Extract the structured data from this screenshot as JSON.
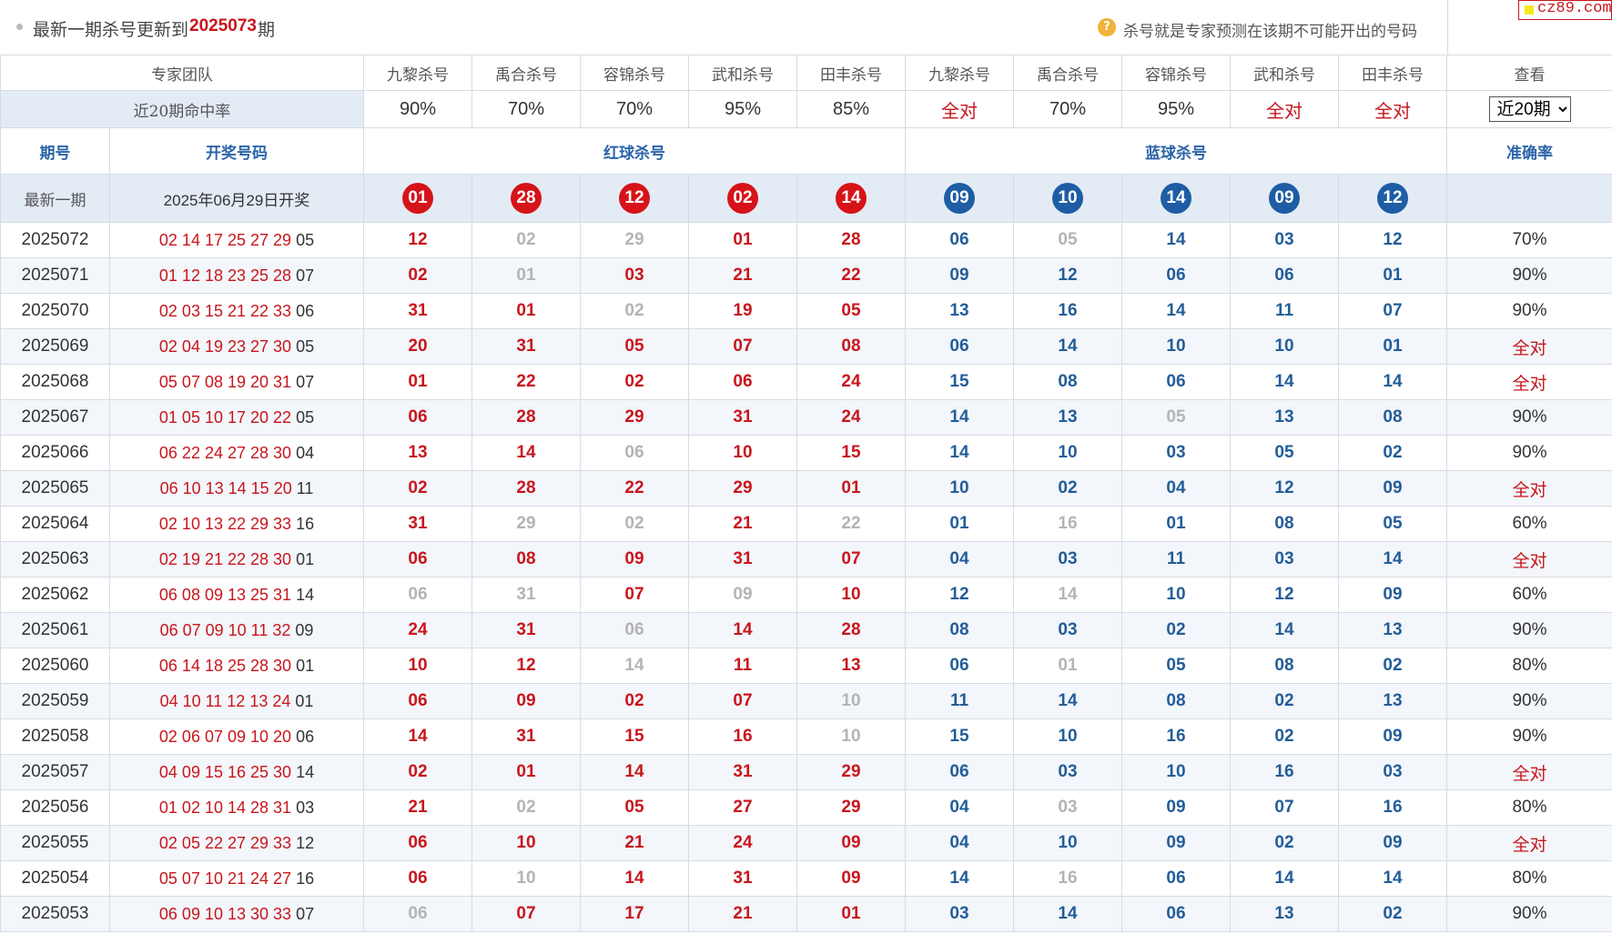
{
  "title": {
    "prefix": "最新一期杀号更新到",
    "issue": "2025073",
    "suffix": "期",
    "hint_icon": "question-icon",
    "hint_glyph": "?",
    "hint": "杀号就是专家预测在该期不可能开出的号码"
  },
  "logo": {
    "text": "cz89.com"
  },
  "header": {
    "team_label": "专家团队",
    "experts": [
      "九黎杀号",
      "禹合杀号",
      "容锦杀号",
      "武和杀号",
      "田丰杀号",
      "九黎杀号",
      "禹合杀号",
      "容锦杀号",
      "武和杀号",
      "田丰杀号"
    ],
    "view_label": "查看",
    "rate_label": "近20期命中率",
    "rates": [
      "90%",
      "70%",
      "70%",
      "95%",
      "85%",
      "全对",
      "70%",
      "95%",
      "全对",
      "全对"
    ],
    "period_select": {
      "selected": "近20期",
      "options": [
        "近20期"
      ]
    },
    "col_issue": "期号",
    "col_draw": "开奖号码",
    "col_red": "红球杀号",
    "col_blue": "蓝球杀号",
    "col_accuracy": "准确率",
    "latest_label": "最新一期",
    "latest_date": "2025年06月29日开奖",
    "latest_red": [
      "01",
      "28",
      "12",
      "02",
      "14"
    ],
    "latest_blue": [
      "09",
      "10",
      "14",
      "09",
      "12"
    ]
  },
  "rows": [
    {
      "issue": "2025072",
      "draw": "02 14 17 25 27 29",
      "blue_ball": "05",
      "red": [
        "12",
        "02",
        "29",
        "01",
        "28"
      ],
      "red_miss": [
        0,
        1,
        1,
        0,
        0
      ],
      "blue": [
        "06",
        "05",
        "14",
        "03",
        "12"
      ],
      "blue_miss": [
        0,
        1,
        0,
        0,
        0
      ],
      "accuracy": "70%"
    },
    {
      "issue": "2025071",
      "draw": "01 12 18 23 25 28",
      "blue_ball": "07",
      "red": [
        "02",
        "01",
        "03",
        "21",
        "22"
      ],
      "red_miss": [
        0,
        1,
        0,
        0,
        0
      ],
      "blue": [
        "09",
        "12",
        "06",
        "06",
        "01"
      ],
      "blue_miss": [
        0,
        0,
        0,
        0,
        0
      ],
      "accuracy": "90%"
    },
    {
      "issue": "2025070",
      "draw": "02 03 15 21 22 33",
      "blue_ball": "06",
      "red": [
        "31",
        "01",
        "02",
        "19",
        "05"
      ],
      "red_miss": [
        0,
        0,
        1,
        0,
        0
      ],
      "blue": [
        "13",
        "16",
        "14",
        "11",
        "07"
      ],
      "blue_miss": [
        0,
        0,
        0,
        0,
        0
      ],
      "accuracy": "90%"
    },
    {
      "issue": "2025069",
      "draw": "02 04 19 23 27 30",
      "blue_ball": "05",
      "red": [
        "20",
        "31",
        "05",
        "07",
        "08"
      ],
      "red_miss": [
        0,
        0,
        0,
        0,
        0
      ],
      "blue": [
        "06",
        "14",
        "10",
        "10",
        "01"
      ],
      "blue_miss": [
        0,
        0,
        0,
        0,
        0
      ],
      "accuracy": "全对"
    },
    {
      "issue": "2025068",
      "draw": "05 07 08 19 20 31",
      "blue_ball": "07",
      "red": [
        "01",
        "22",
        "02",
        "06",
        "24"
      ],
      "red_miss": [
        0,
        0,
        0,
        0,
        0
      ],
      "blue": [
        "15",
        "08",
        "06",
        "14",
        "14"
      ],
      "blue_miss": [
        0,
        0,
        0,
        0,
        0
      ],
      "accuracy": "全对"
    },
    {
      "issue": "2025067",
      "draw": "01 05 10 17 20 22",
      "blue_ball": "05",
      "red": [
        "06",
        "28",
        "29",
        "31",
        "24"
      ],
      "red_miss": [
        0,
        0,
        0,
        0,
        0
      ],
      "blue": [
        "14",
        "13",
        "05",
        "13",
        "08"
      ],
      "blue_miss": [
        0,
        0,
        1,
        0,
        0
      ],
      "accuracy": "90%"
    },
    {
      "issue": "2025066",
      "draw": "06 22 24 27 28 30",
      "blue_ball": "04",
      "red": [
        "13",
        "14",
        "06",
        "10",
        "15"
      ],
      "red_miss": [
        0,
        0,
        1,
        0,
        0
      ],
      "blue": [
        "14",
        "10",
        "03",
        "05",
        "02"
      ],
      "blue_miss": [
        0,
        0,
        0,
        0,
        0
      ],
      "accuracy": "90%"
    },
    {
      "issue": "2025065",
      "draw": "06 10 13 14 15 20",
      "blue_ball": "11",
      "red": [
        "02",
        "28",
        "22",
        "29",
        "01"
      ],
      "red_miss": [
        0,
        0,
        0,
        0,
        0
      ],
      "blue": [
        "10",
        "02",
        "04",
        "12",
        "09"
      ],
      "blue_miss": [
        0,
        0,
        0,
        0,
        0
      ],
      "accuracy": "全对"
    },
    {
      "issue": "2025064",
      "draw": "02 10 13 22 29 33",
      "blue_ball": "16",
      "red": [
        "31",
        "29",
        "02",
        "21",
        "22"
      ],
      "red_miss": [
        0,
        1,
        1,
        0,
        1
      ],
      "blue": [
        "01",
        "16",
        "01",
        "08",
        "05"
      ],
      "blue_miss": [
        0,
        1,
        0,
        0,
        0
      ],
      "accuracy": "60%"
    },
    {
      "issue": "2025063",
      "draw": "02 19 21 22 28 30",
      "blue_ball": "01",
      "red": [
        "06",
        "08",
        "09",
        "31",
        "07"
      ],
      "red_miss": [
        0,
        0,
        0,
        0,
        0
      ],
      "blue": [
        "04",
        "03",
        "11",
        "03",
        "14"
      ],
      "blue_miss": [
        0,
        0,
        0,
        0,
        0
      ],
      "accuracy": "全对"
    },
    {
      "issue": "2025062",
      "draw": "06 08 09 13 25 31",
      "blue_ball": "14",
      "red": [
        "06",
        "31",
        "07",
        "09",
        "10"
      ],
      "red_miss": [
        1,
        1,
        0,
        1,
        0
      ],
      "blue": [
        "12",
        "14",
        "10",
        "12",
        "09"
      ],
      "blue_miss": [
        0,
        1,
        0,
        0,
        0
      ],
      "accuracy": "60%"
    },
    {
      "issue": "2025061",
      "draw": "06 07 09 10 11 32",
      "blue_ball": "09",
      "red": [
        "24",
        "31",
        "06",
        "14",
        "28"
      ],
      "red_miss": [
        0,
        0,
        1,
        0,
        0
      ],
      "blue": [
        "08",
        "03",
        "02",
        "14",
        "13"
      ],
      "blue_miss": [
        0,
        0,
        0,
        0,
        0
      ],
      "accuracy": "90%"
    },
    {
      "issue": "2025060",
      "draw": "06 14 18 25 28 30",
      "blue_ball": "01",
      "red": [
        "10",
        "12",
        "14",
        "11",
        "13"
      ],
      "red_miss": [
        0,
        0,
        1,
        0,
        0
      ],
      "blue": [
        "06",
        "01",
        "05",
        "08",
        "02"
      ],
      "blue_miss": [
        0,
        1,
        0,
        0,
        0
      ],
      "accuracy": "80%"
    },
    {
      "issue": "2025059",
      "draw": "04 10 11 12 13 24",
      "blue_ball": "01",
      "red": [
        "06",
        "09",
        "02",
        "07",
        "10"
      ],
      "red_miss": [
        0,
        0,
        0,
        0,
        1
      ],
      "blue": [
        "11",
        "14",
        "08",
        "02",
        "13"
      ],
      "blue_miss": [
        0,
        0,
        0,
        0,
        0
      ],
      "accuracy": "90%"
    },
    {
      "issue": "2025058",
      "draw": "02 06 07 09 10 20",
      "blue_ball": "06",
      "red": [
        "14",
        "31",
        "15",
        "16",
        "10"
      ],
      "red_miss": [
        0,
        0,
        0,
        0,
        1
      ],
      "blue": [
        "15",
        "10",
        "16",
        "02",
        "09"
      ],
      "blue_miss": [
        0,
        0,
        0,
        0,
        0
      ],
      "accuracy": "90%"
    },
    {
      "issue": "2025057",
      "draw": "04 09 15 16 25 30",
      "blue_ball": "14",
      "red": [
        "02",
        "01",
        "14",
        "31",
        "29"
      ],
      "red_miss": [
        0,
        0,
        0,
        0,
        0
      ],
      "blue": [
        "06",
        "03",
        "10",
        "16",
        "03"
      ],
      "blue_miss": [
        0,
        0,
        0,
        0,
        0
      ],
      "accuracy": "全对"
    },
    {
      "issue": "2025056",
      "draw": "01 02 10 14 28 31",
      "blue_ball": "03",
      "red": [
        "21",
        "02",
        "05",
        "27",
        "29"
      ],
      "red_miss": [
        0,
        1,
        0,
        0,
        0
      ],
      "blue": [
        "04",
        "03",
        "09",
        "07",
        "16"
      ],
      "blue_miss": [
        0,
        1,
        0,
        0,
        0
      ],
      "accuracy": "80%"
    },
    {
      "issue": "2025055",
      "draw": "02 05 22 27 29 33",
      "blue_ball": "12",
      "red": [
        "06",
        "10",
        "21",
        "24",
        "09"
      ],
      "red_miss": [
        0,
        0,
        0,
        0,
        0
      ],
      "blue": [
        "04",
        "10",
        "09",
        "02",
        "09"
      ],
      "blue_miss": [
        0,
        0,
        0,
        0,
        0
      ],
      "accuracy": "全对"
    },
    {
      "issue": "2025054",
      "draw": "05 07 10 21 24 27",
      "blue_ball": "16",
      "red": [
        "06",
        "10",
        "14",
        "31",
        "09"
      ],
      "red_miss": [
        0,
        1,
        0,
        0,
        0
      ],
      "blue": [
        "14",
        "16",
        "06",
        "14",
        "14"
      ],
      "blue_miss": [
        0,
        1,
        0,
        0,
        0
      ],
      "accuracy": "80%"
    },
    {
      "issue": "2025053",
      "draw": "06 09 10 13 30 33",
      "blue_ball": "07",
      "red": [
        "06",
        "07",
        "17",
        "21",
        "01"
      ],
      "red_miss": [
        1,
        0,
        0,
        0,
        0
      ],
      "blue": [
        "03",
        "14",
        "06",
        "13",
        "02"
      ],
      "blue_miss": [
        0,
        0,
        0,
        0,
        0
      ],
      "accuracy": "90%"
    }
  ],
  "colors": {
    "red": "#c8161d",
    "blue": "#235d99",
    "miss": "#b4b4b4",
    "header_bg": "#e3ebf5",
    "alt_row_bg": "#f3f6fa"
  }
}
